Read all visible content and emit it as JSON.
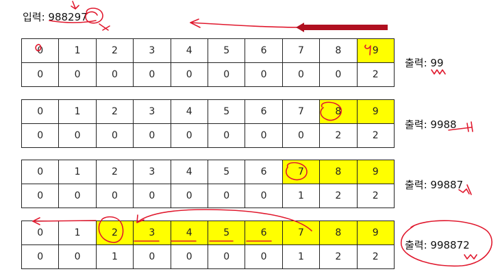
{
  "input": {
    "label": "입력: 988297"
  },
  "steps": [
    {
      "index_row": [
        "0",
        "1",
        "2",
        "3",
        "4",
        "5",
        "6",
        "7",
        "8",
        "9"
      ],
      "count_row": [
        "0",
        "0",
        "0",
        "0",
        "0",
        "0",
        "0",
        "0",
        "0",
        "2"
      ],
      "highlighted": [
        9
      ],
      "output_label": "출력: 99"
    },
    {
      "index_row": [
        "0",
        "1",
        "2",
        "3",
        "4",
        "5",
        "6",
        "7",
        "8",
        "9"
      ],
      "count_row": [
        "0",
        "0",
        "0",
        "0",
        "0",
        "0",
        "0",
        "0",
        "2",
        "2"
      ],
      "highlighted": [
        8,
        9
      ],
      "output_label": "출력: 9988"
    },
    {
      "index_row": [
        "0",
        "1",
        "2",
        "3",
        "4",
        "5",
        "6",
        "7",
        "8",
        "9"
      ],
      "count_row": [
        "0",
        "0",
        "0",
        "0",
        "0",
        "0",
        "0",
        "1",
        "2",
        "2"
      ],
      "highlighted": [
        7,
        8,
        9
      ],
      "output_label": "출력: 99887"
    },
    {
      "index_row": [
        "0",
        "1",
        "2",
        "3",
        "4",
        "5",
        "6",
        "7",
        "8",
        "9"
      ],
      "count_row": [
        "0",
        "0",
        "1",
        "0",
        "0",
        "0",
        "0",
        "1",
        "2",
        "2"
      ],
      "highlighted": [
        2,
        3,
        4,
        5,
        6,
        7,
        8,
        9
      ],
      "output_label": "출력: 998872"
    }
  ],
  "colors": {
    "highlight": "#ffff00",
    "annotation_ink": "#e0182d",
    "arrow_dark": "#b01020"
  }
}
